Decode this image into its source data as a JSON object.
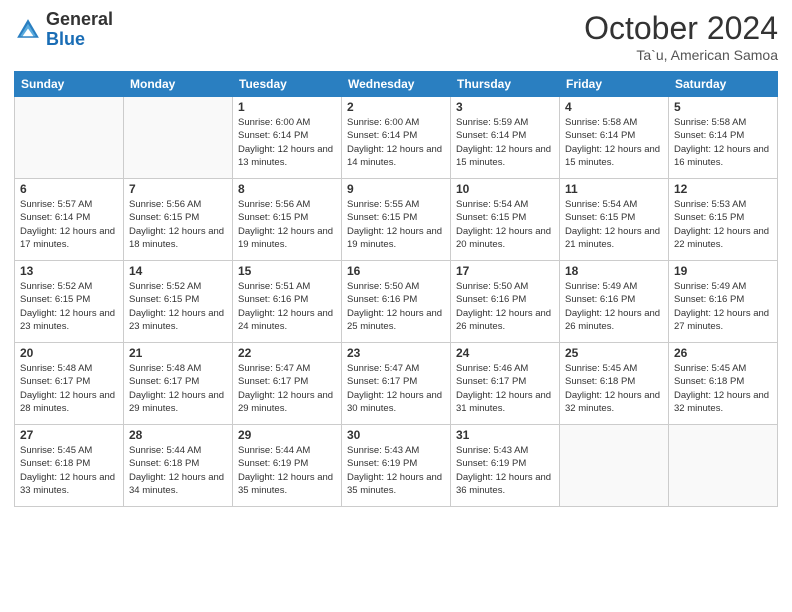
{
  "logo": {
    "general": "General",
    "blue": "Blue"
  },
  "header": {
    "month": "October 2024",
    "location": "Ta`u, American Samoa"
  },
  "weekdays": [
    "Sunday",
    "Monday",
    "Tuesday",
    "Wednesday",
    "Thursday",
    "Friday",
    "Saturday"
  ],
  "weeks": [
    [
      {
        "day": "",
        "info": ""
      },
      {
        "day": "",
        "info": ""
      },
      {
        "day": "1",
        "info": "Sunrise: 6:00 AM\nSunset: 6:14 PM\nDaylight: 12 hours and 13 minutes."
      },
      {
        "day": "2",
        "info": "Sunrise: 6:00 AM\nSunset: 6:14 PM\nDaylight: 12 hours and 14 minutes."
      },
      {
        "day": "3",
        "info": "Sunrise: 5:59 AM\nSunset: 6:14 PM\nDaylight: 12 hours and 15 minutes."
      },
      {
        "day": "4",
        "info": "Sunrise: 5:58 AM\nSunset: 6:14 PM\nDaylight: 12 hours and 15 minutes."
      },
      {
        "day": "5",
        "info": "Sunrise: 5:58 AM\nSunset: 6:14 PM\nDaylight: 12 hours and 16 minutes."
      }
    ],
    [
      {
        "day": "6",
        "info": "Sunrise: 5:57 AM\nSunset: 6:14 PM\nDaylight: 12 hours and 17 minutes."
      },
      {
        "day": "7",
        "info": "Sunrise: 5:56 AM\nSunset: 6:15 PM\nDaylight: 12 hours and 18 minutes."
      },
      {
        "day": "8",
        "info": "Sunrise: 5:56 AM\nSunset: 6:15 PM\nDaylight: 12 hours and 19 minutes."
      },
      {
        "day": "9",
        "info": "Sunrise: 5:55 AM\nSunset: 6:15 PM\nDaylight: 12 hours and 19 minutes."
      },
      {
        "day": "10",
        "info": "Sunrise: 5:54 AM\nSunset: 6:15 PM\nDaylight: 12 hours and 20 minutes."
      },
      {
        "day": "11",
        "info": "Sunrise: 5:54 AM\nSunset: 6:15 PM\nDaylight: 12 hours and 21 minutes."
      },
      {
        "day": "12",
        "info": "Sunrise: 5:53 AM\nSunset: 6:15 PM\nDaylight: 12 hours and 22 minutes."
      }
    ],
    [
      {
        "day": "13",
        "info": "Sunrise: 5:52 AM\nSunset: 6:15 PM\nDaylight: 12 hours and 23 minutes."
      },
      {
        "day": "14",
        "info": "Sunrise: 5:52 AM\nSunset: 6:15 PM\nDaylight: 12 hours and 23 minutes."
      },
      {
        "day": "15",
        "info": "Sunrise: 5:51 AM\nSunset: 6:16 PM\nDaylight: 12 hours and 24 minutes."
      },
      {
        "day": "16",
        "info": "Sunrise: 5:50 AM\nSunset: 6:16 PM\nDaylight: 12 hours and 25 minutes."
      },
      {
        "day": "17",
        "info": "Sunrise: 5:50 AM\nSunset: 6:16 PM\nDaylight: 12 hours and 26 minutes."
      },
      {
        "day": "18",
        "info": "Sunrise: 5:49 AM\nSunset: 6:16 PM\nDaylight: 12 hours and 26 minutes."
      },
      {
        "day": "19",
        "info": "Sunrise: 5:49 AM\nSunset: 6:16 PM\nDaylight: 12 hours and 27 minutes."
      }
    ],
    [
      {
        "day": "20",
        "info": "Sunrise: 5:48 AM\nSunset: 6:17 PM\nDaylight: 12 hours and 28 minutes."
      },
      {
        "day": "21",
        "info": "Sunrise: 5:48 AM\nSunset: 6:17 PM\nDaylight: 12 hours and 29 minutes."
      },
      {
        "day": "22",
        "info": "Sunrise: 5:47 AM\nSunset: 6:17 PM\nDaylight: 12 hours and 29 minutes."
      },
      {
        "day": "23",
        "info": "Sunrise: 5:47 AM\nSunset: 6:17 PM\nDaylight: 12 hours and 30 minutes."
      },
      {
        "day": "24",
        "info": "Sunrise: 5:46 AM\nSunset: 6:17 PM\nDaylight: 12 hours and 31 minutes."
      },
      {
        "day": "25",
        "info": "Sunrise: 5:45 AM\nSunset: 6:18 PM\nDaylight: 12 hours and 32 minutes."
      },
      {
        "day": "26",
        "info": "Sunrise: 5:45 AM\nSunset: 6:18 PM\nDaylight: 12 hours and 32 minutes."
      }
    ],
    [
      {
        "day": "27",
        "info": "Sunrise: 5:45 AM\nSunset: 6:18 PM\nDaylight: 12 hours and 33 minutes."
      },
      {
        "day": "28",
        "info": "Sunrise: 5:44 AM\nSunset: 6:18 PM\nDaylight: 12 hours and 34 minutes."
      },
      {
        "day": "29",
        "info": "Sunrise: 5:44 AM\nSunset: 6:19 PM\nDaylight: 12 hours and 35 minutes."
      },
      {
        "day": "30",
        "info": "Sunrise: 5:43 AM\nSunset: 6:19 PM\nDaylight: 12 hours and 35 minutes."
      },
      {
        "day": "31",
        "info": "Sunrise: 5:43 AM\nSunset: 6:19 PM\nDaylight: 12 hours and 36 minutes."
      },
      {
        "day": "",
        "info": ""
      },
      {
        "day": "",
        "info": ""
      }
    ]
  ]
}
